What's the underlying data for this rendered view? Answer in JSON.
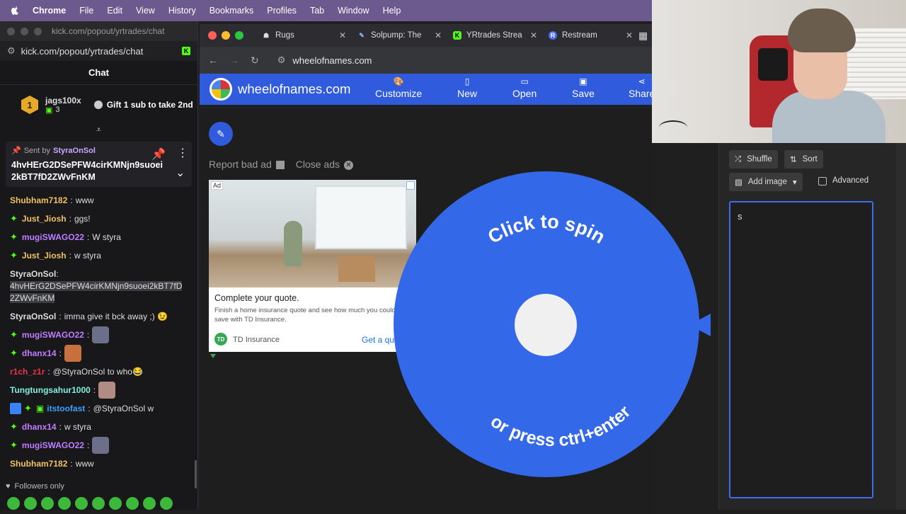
{
  "menubar": {
    "items": [
      "Chrome",
      "File",
      "Edit",
      "View",
      "History",
      "Bookmarks",
      "Profiles",
      "Tab",
      "Window",
      "Help"
    ]
  },
  "kick": {
    "window_url": "kick.com/popout/yrtrades/chat",
    "address": "kick.com/popout/yrtrades/chat",
    "chat_title": "Chat",
    "leader": {
      "rank": "1",
      "name": "jags100x",
      "count": "3",
      "gift_text": "Gift 1 sub to take 2nd"
    },
    "pinned": {
      "sent_by_label": "Sent by",
      "sent_by_user": "StyraOnSol",
      "message": "4hvHErG2DSePFW4cirKMNjn9suoei2kBT7fD2ZWvFnKM"
    },
    "messages": [
      {
        "user": "Shubham7182",
        "color": "#f0c060",
        "text": "www",
        "badges": []
      },
      {
        "user": "Just_Jiosh",
        "color": "#f0c060",
        "text": "ggs!",
        "badges": [
          "spark"
        ]
      },
      {
        "user": "mugiSWAGO22",
        "color": "#c07cff",
        "text": "W styra",
        "badges": [
          "spark"
        ]
      },
      {
        "user": "Just_Jiosh",
        "color": "#f0c060",
        "text": "w styra",
        "badges": [
          "spark"
        ]
      },
      {
        "user": "StyraOnSol",
        "color": "#ddd",
        "text": "4hvHErG2DSePFW4cirKMNjn9suoei2kBT7fD2ZWvFnKM",
        "badges": []
      },
      {
        "user": "StyraOnSol",
        "color": "#ddd",
        "text": "imma give it bck away ;) 😉",
        "badges": []
      },
      {
        "user": "mugiSWAGO22",
        "color": "#c07cff",
        "text": "",
        "badges": [
          "spark"
        ]
      },
      {
        "user": "dhanx14",
        "color": "#c07cff",
        "text": "",
        "badges": [
          "spark"
        ]
      },
      {
        "user": "r1ch_z1r",
        "color": "#e8334a",
        "text": "@StyraOnSol to who😂",
        "badges": []
      },
      {
        "user": "Tungtungsahur1000",
        "color": "#7ef0e0",
        "text": "",
        "badges": []
      },
      {
        "user": "itstoofast",
        "color": "#3aa0ff",
        "text": "@StyraOnSol w",
        "badges": [
          "blue",
          "spark",
          "gift"
        ]
      },
      {
        "user": "dhanx14",
        "color": "#c07cff",
        "text": "w styra",
        "badges": [
          "spark"
        ]
      },
      {
        "user": "mugiSWAGO22",
        "color": "#c07cff",
        "text": "",
        "badges": [
          "spark"
        ]
      },
      {
        "user": "Shubham7182",
        "color": "#f0c060",
        "text": "www",
        "badges": []
      }
    ],
    "followers_only": "Followers only"
  },
  "chrome": {
    "tabs": [
      {
        "label": "Rugs",
        "favicon": "rugs"
      },
      {
        "label": "Solpump: The",
        "favicon": "solpump"
      },
      {
        "label": "YRtrades Strea",
        "favicon": "kick"
      },
      {
        "label": "Restream",
        "favicon": "restream"
      }
    ],
    "address": "wheelofnames.com"
  },
  "won": {
    "brand": "wheelofnames.com",
    "nav": [
      "Customize",
      "New",
      "Open",
      "Save",
      "Share"
    ],
    "report_ad": "Report bad ad",
    "close_ads": "Close ads",
    "ad": {
      "tag": "Ad",
      "headline": "Complete your quote.",
      "description": "Finish a home insurance quote and see how much you could save with TD Insurance.",
      "advertiser": "TD Insurance",
      "logo_text": "TD",
      "cta": "Get a quote"
    },
    "wheel_text_top": "Click to spin",
    "wheel_text_bottom": "or press ctrl+enter",
    "wheel_color": "#3369e8",
    "shuffle": "Shuffle",
    "sort": "Sort",
    "add_image": "Add image",
    "advanced": "Advanced",
    "entries_value": "s"
  }
}
